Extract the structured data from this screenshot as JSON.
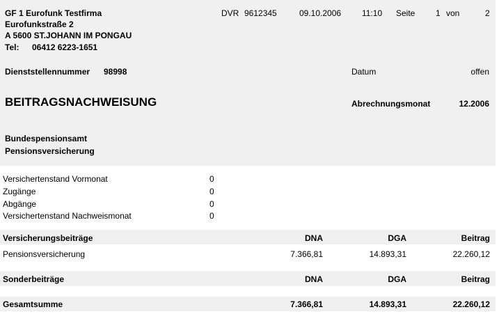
{
  "colors": {
    "band_background": "#f0f0f0",
    "page_background": "#ffffff",
    "text": "#000000"
  },
  "header": {
    "company_name": "GF 1 Eurofunk Testfirma",
    "street": "Eurofunkstraße 2",
    "city": "A 5600 ST.JOHANN IM PONGAU",
    "phone_label": "Tel:",
    "phone": "06412 6223-1651",
    "dvr_label": "DVR",
    "dvr_number": "9612345",
    "date": "09.10.2006",
    "time": "11:10",
    "page_label": "Seite",
    "page_current": "1",
    "page_of_label": "von",
    "page_total": "2"
  },
  "office": {
    "label": "Dienststellennummer",
    "number": "98998",
    "datum_label": "Datum",
    "datum_value": "offen"
  },
  "title": {
    "main": "BEITRAGSNACHWEISUNG",
    "month_label": "Abrechnungsmonat",
    "month_value": "12.2006"
  },
  "recipient": {
    "line1": "Bundespensionsamt",
    "line2": "Pensionsversicherung"
  },
  "insured_stats": [
    {
      "label": "Versichertenstand Vormonat",
      "value": "0"
    },
    {
      "label": "Zugänge",
      "value": "0"
    },
    {
      "label": "Abgänge",
      "value": "0"
    },
    {
      "label": "Versichertenstand Nachweismonat",
      "value": "0"
    }
  ],
  "contributions": {
    "header": {
      "label": "Versicherungsbeiträge",
      "col1": "DNA",
      "col2": "DGA",
      "col3": "Beitrag"
    },
    "rows": [
      {
        "label": "Pensionsversicherung",
        "dna": "7.366,81",
        "dga": "14.893,31",
        "beitrag": "22.260,12"
      }
    ]
  },
  "special": {
    "header": {
      "label": "Sonderbeiträge",
      "col1": "DNA",
      "col2": "DGA",
      "col3": "Beitrag"
    }
  },
  "total": {
    "label": "Gesamtsumme",
    "dna": "7.366,81",
    "dga": "14.893,31",
    "beitrag": "22.260,12"
  }
}
